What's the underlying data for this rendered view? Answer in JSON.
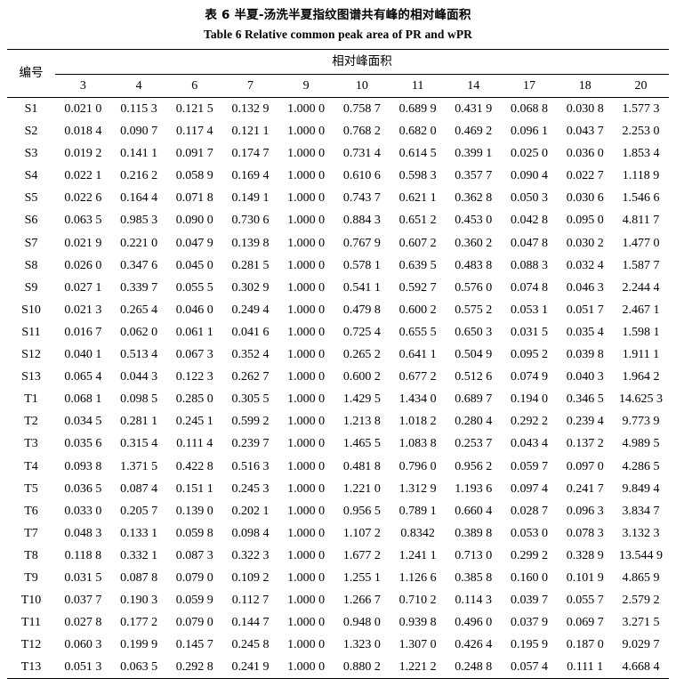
{
  "titles": {
    "cn": "表 6   半夏-汤洗半夏指纹图谱共有峰的相对峰面积",
    "en": "Table 6   Relative common peak area of PR and wPR"
  },
  "table": {
    "id_column_header": "编号",
    "group_header": "相对峰面积",
    "columns": [
      "3",
      "4",
      "6",
      "7",
      "9",
      "10",
      "11",
      "14",
      "17",
      "18",
      "20"
    ],
    "rows": [
      {
        "id": "S1",
        "values": [
          "0.021 0",
          "0.115 3",
          "0.121 5",
          "0.132 9",
          "1.000 0",
          "0.758 7",
          "0.689 9",
          "0.431 9",
          "0.068 8",
          "0.030 8",
          "1.577 3"
        ]
      },
      {
        "id": "S2",
        "values": [
          "0.018 4",
          "0.090 7",
          "0.117 4",
          "0.121 1",
          "1.000 0",
          "0.768 2",
          "0.682 0",
          "0.469 2",
          "0.096 1",
          "0.043 7",
          "2.253 0"
        ]
      },
      {
        "id": "S3",
        "values": [
          "0.019 2",
          "0.141 1",
          "0.091 7",
          "0.174 7",
          "1.000 0",
          "0.731 4",
          "0.614 5",
          "0.399 1",
          "0.025 0",
          "0.036 0",
          "1.853 4"
        ]
      },
      {
        "id": "S4",
        "values": [
          "0.022 1",
          "0.216 2",
          "0.058 9",
          "0.169 4",
          "1.000 0",
          "0.610 6",
          "0.598 3",
          "0.357 7",
          "0.090 4",
          "0.022 7",
          "1.118 9"
        ]
      },
      {
        "id": "S5",
        "values": [
          "0.022 6",
          "0.164 4",
          "0.071 8",
          "0.149 1",
          "1.000 0",
          "0.743 7",
          "0.621 1",
          "0.362 8",
          "0.050 3",
          "0.030 6",
          "1.546 6"
        ]
      },
      {
        "id": "S6",
        "values": [
          "0.063 5",
          "0.985 3",
          "0.090 0",
          "0.730 6",
          "1.000 0",
          "0.884 3",
          "0.651 2",
          "0.453 0",
          "0.042 8",
          "0.095 0",
          "4.811 7"
        ]
      },
      {
        "id": "S7",
        "values": [
          "0.021 9",
          "0.221 0",
          "0.047 9",
          "0.139 8",
          "1.000 0",
          "0.767 9",
          "0.607 2",
          "0.360 2",
          "0.047 8",
          "0.030 2",
          "1.477 0"
        ]
      },
      {
        "id": "S8",
        "values": [
          "0.026 0",
          "0.347 6",
          "0.045 0",
          "0.281 5",
          "1.000 0",
          "0.578 1",
          "0.639 5",
          "0.483 8",
          "0.088 3",
          "0.032 4",
          "1.587 7"
        ]
      },
      {
        "id": "S9",
        "values": [
          "0.027 1",
          "0.339 7",
          "0.055 5",
          "0.302 9",
          "1.000 0",
          "0.541 1",
          "0.592 7",
          "0.576 0",
          "0.074 8",
          "0.046 3",
          "2.244 4"
        ]
      },
      {
        "id": "S10",
        "values": [
          "0.021 3",
          "0.265 4",
          "0.046 0",
          "0.249 4",
          "1.000 0",
          "0.479 8",
          "0.600 2",
          "0.575 2",
          "0.053 1",
          "0.051 7",
          "2.467 1"
        ]
      },
      {
        "id": "S11",
        "values": [
          "0.016 7",
          "0.062 0",
          "0.061 1",
          "0.041 6",
          "1.000 0",
          "0.725 4",
          "0.655 5",
          "0.650 3",
          "0.031 5",
          "0.035 4",
          "1.598 1"
        ]
      },
      {
        "id": "S12",
        "values": [
          "0.040 1",
          "0.513 4",
          "0.067 3",
          "0.352 4",
          "1.000 0",
          "0.265 2",
          "0.641 1",
          "0.504 9",
          "0.095 2",
          "0.039 8",
          "1.911 1"
        ]
      },
      {
        "id": "S13",
        "values": [
          "0.065 4",
          "0.044 3",
          "0.122 3",
          "0.262 7",
          "1.000 0",
          "0.600 2",
          "0.677 2",
          "0.512 6",
          "0.074 9",
          "0.040 3",
          "1.964 2"
        ]
      },
      {
        "id": "T1",
        "values": [
          "0.068 1",
          "0.098 5",
          "0.285 0",
          "0.305 5",
          "1.000 0",
          "1.429 5",
          "1.434 0",
          "0.689 7",
          "0.194 0",
          "0.346 5",
          "14.625 3"
        ]
      },
      {
        "id": "T2",
        "values": [
          "0.034 5",
          "0.281 1",
          "0.245 1",
          "0.599 2",
          "1.000 0",
          "1.213 8",
          "1.018 2",
          "0.280 4",
          "0.292 2",
          "0.239 4",
          "9.773 9"
        ]
      },
      {
        "id": "T3",
        "values": [
          "0.035 6",
          "0.315 4",
          "0.111 4",
          "0.239 7",
          "1.000 0",
          "1.465 5",
          "1.083 8",
          "0.253 7",
          "0.043 4",
          "0.137 2",
          "4.989 5"
        ]
      },
      {
        "id": "T4",
        "values": [
          "0.093 8",
          "1.371 5",
          "0.422 8",
          "0.516 3",
          "1.000 0",
          "0.481 8",
          "0.796 0",
          "0.956 2",
          "0.059 7",
          "0.097 0",
          "4.286 5"
        ]
      },
      {
        "id": "T5",
        "values": [
          "0.036 5",
          "0.087 4",
          "0.151 1",
          "0.245 3",
          "1.000 0",
          "1.221 0",
          "1.312 9",
          "1.193 6",
          "0.097 4",
          "0.241 7",
          "9.849 4"
        ]
      },
      {
        "id": "T6",
        "values": [
          "0.033 0",
          "0.205 7",
          "0.139 0",
          "0.202 1",
          "1.000 0",
          "0.956 5",
          "0.789 1",
          "0.660 4",
          "0.028 7",
          "0.096 3",
          "3.834 7"
        ]
      },
      {
        "id": "T7",
        "values": [
          "0.048 3",
          "0.133 1",
          "0.059 8",
          "0.098 4",
          "1.000 0",
          "1.107 2",
          "0.8342",
          "0.389 8",
          "0.053 0",
          "0.078 3",
          "3.132 3"
        ]
      },
      {
        "id": "T8",
        "values": [
          "0.118 8",
          "0.332 1",
          "0.087 3",
          "0.322 3",
          "1.000 0",
          "1.677 2",
          "1.241 1",
          "0.713 0",
          "0.299 2",
          "0.328 9",
          "13.544 9"
        ]
      },
      {
        "id": "T9",
        "values": [
          "0.031 5",
          "0.087 8",
          "0.079 0",
          "0.109 2",
          "1.000 0",
          "1.255 1",
          "1.126 6",
          "0.385 8",
          "0.160 0",
          "0.101 9",
          "4.865 9"
        ]
      },
      {
        "id": "T10",
        "values": [
          "0.037 7",
          "0.190 3",
          "0.059 9",
          "0.112 7",
          "1.000 0",
          "1.266 7",
          "0.710 2",
          "0.114 3",
          "0.039 7",
          "0.055 7",
          "2.579 2"
        ]
      },
      {
        "id": "T11",
        "values": [
          "0.027 8",
          "0.177 2",
          "0.079 0",
          "0.144 7",
          "1.000 0",
          "0.948 0",
          "0.939 8",
          "0.496 0",
          "0.037 9",
          "0.069 7",
          "3.271 5"
        ]
      },
      {
        "id": "T12",
        "values": [
          "0.060 3",
          "0.199 9",
          "0.145 7",
          "0.245 8",
          "1.000 0",
          "1.323 0",
          "1.307 0",
          "0.426 4",
          "0.195 9",
          "0.187 0",
          "9.029 7"
        ]
      },
      {
        "id": "T13",
        "values": [
          "0.051 3",
          "0.063 5",
          "0.292 8",
          "0.241 9",
          "1.000 0",
          "0.880 2",
          "1.221 2",
          "0.248 8",
          "0.057 4",
          "0.111 1",
          "4.668 4"
        ]
      }
    ]
  }
}
